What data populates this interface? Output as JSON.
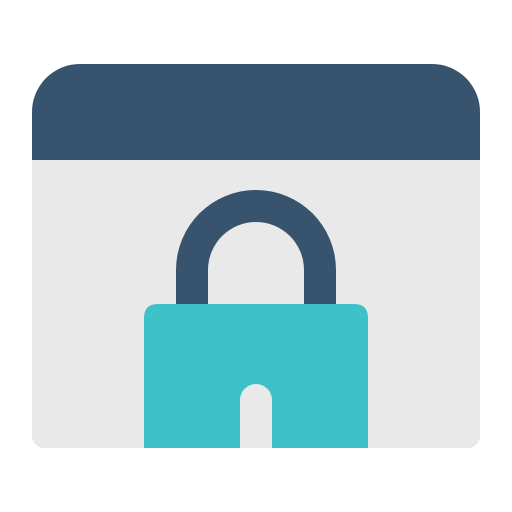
{
  "icon": {
    "name": "browser-lock-icon",
    "colors": {
      "window_body": "#e9e9ea",
      "title_bar": "#37536d",
      "lock_body": "#3ec1c9",
      "shackle": "#37536d",
      "keyhole": "#e9e9ea"
    }
  }
}
